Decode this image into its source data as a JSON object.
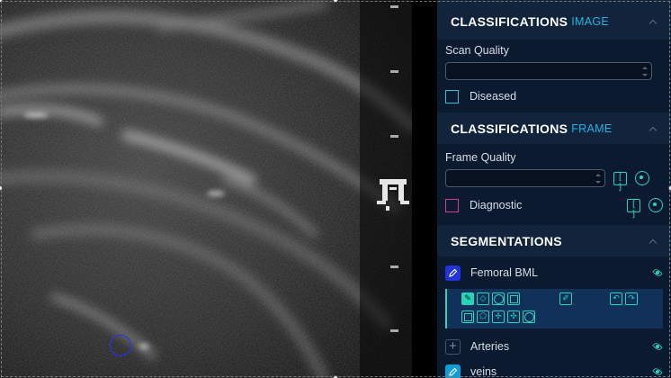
{
  "viewer": {
    "cursor_tool": "brush-circle"
  },
  "panel": {
    "classifications_image": {
      "title": "CLASSIFICATIONS",
      "subtitle": "IMAGE",
      "scan_quality_label": "Scan Quality",
      "scan_quality_value": "",
      "diseased_label": "Diseased"
    },
    "classifications_frame": {
      "title": "CLASSIFICATIONS",
      "subtitle": "FRAME",
      "frame_quality_label": "Frame Quality",
      "frame_quality_value": "",
      "diagnostic_label": "Diagnostic",
      "range_glyph": "[ ]"
    },
    "segmentations": {
      "title": "SEGMENTATIONS",
      "items": [
        {
          "label": "Femoral BML",
          "icon": "pencil-icon",
          "color": "#2233dd"
        },
        {
          "label": "Arteries",
          "icon": "plus-icon",
          "color": "#43536a"
        },
        {
          "label": "veins",
          "icon": "pencil-icon",
          "color": "#0e9fd9"
        }
      ]
    },
    "colors": {
      "panel_bg": "#0b1a2f",
      "header_bg": "#12233c",
      "accent": "#28d4b5",
      "subtitle": "#1fb3e0",
      "diseased_box": "#24c5d9",
      "diagnostic_box": "#d63c8b"
    }
  }
}
